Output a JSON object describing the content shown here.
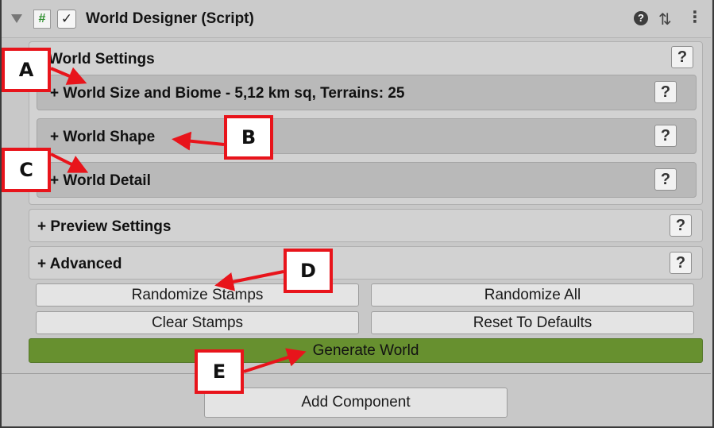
{
  "header": {
    "script_icon": "#",
    "enabled_check": "✓",
    "title": "World Designer (Script)",
    "help_glyph": "?",
    "presets_glyph": "⇅",
    "menu_glyph": "⋮"
  },
  "world_settings": {
    "label": "World Settings",
    "items": [
      {
        "label": "+ World Size and Biome - 5,12 km sq, Terrains: 25"
      },
      {
        "label": "+ World Shape"
      },
      {
        "label": "+ World Detail"
      }
    ]
  },
  "preview_settings": {
    "label": "+ Preview Settings"
  },
  "advanced": {
    "label": "+ Advanced"
  },
  "help_button_glyph": "?",
  "buttons": {
    "randomize_stamps": "Randomize Stamps",
    "randomize_all": "Randomize All",
    "clear_stamps": "Clear Stamps",
    "reset_defaults": "Reset To Defaults",
    "generate_world": "Generate World",
    "add_component": "Add Component"
  },
  "callouts": {
    "a": "A",
    "b": "B",
    "c": "C",
    "d": "D",
    "e": "E"
  },
  "colors": {
    "generate_green": "#67902f",
    "callout_red": "#e8141b",
    "panel_gray": "#d2d2d2",
    "subpanel_gray": "#b9b9b9"
  }
}
